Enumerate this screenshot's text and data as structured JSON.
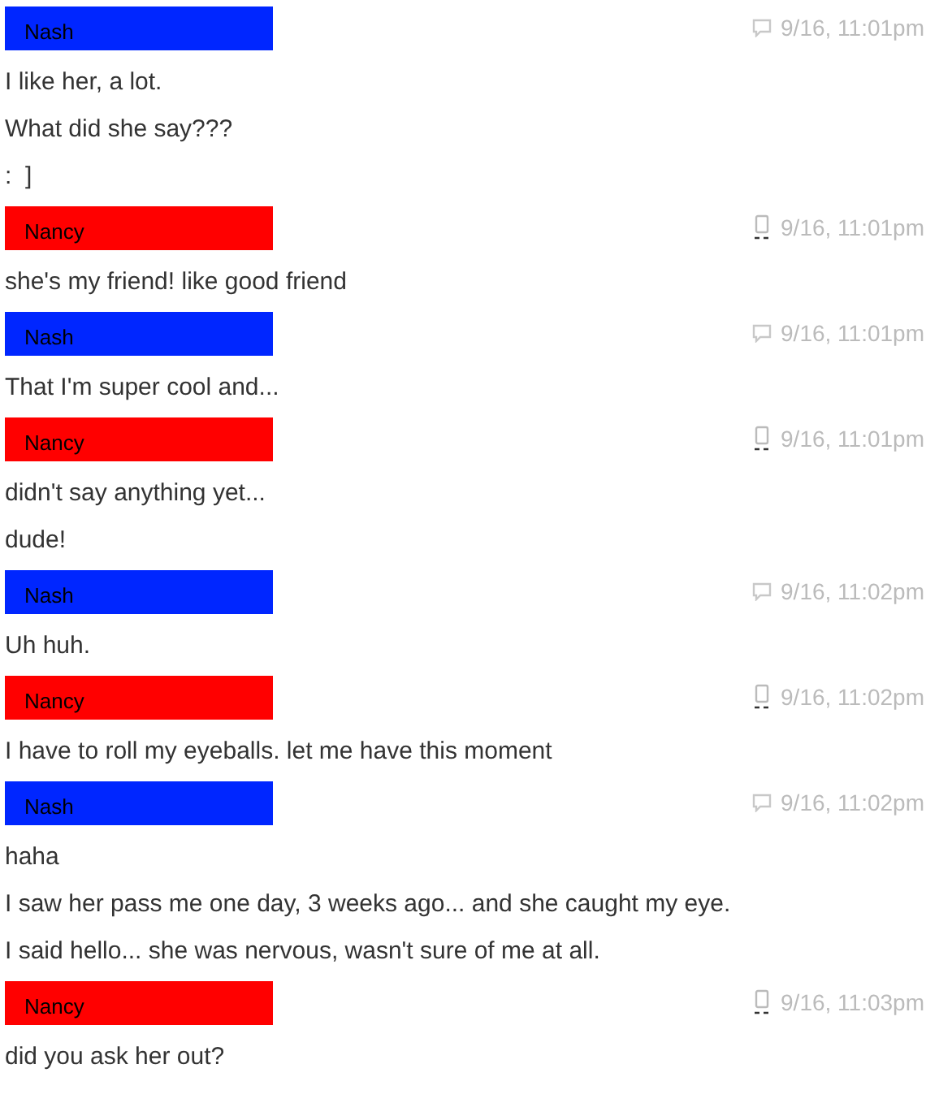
{
  "groups": [
    {
      "sender": "Nash",
      "color": "#0026ff",
      "kind": "chat",
      "time": "9/16, 11:01pm",
      "messages": [
        "I like her, a lot.",
        "What did she say???",
        ":  ]"
      ]
    },
    {
      "sender": "Nancy",
      "color": "#ff0000",
      "kind": "phone",
      "time": "9/16, 11:01pm",
      "messages": [
        "she's my friend! like good friend"
      ]
    },
    {
      "sender": "Nash",
      "color": "#0026ff",
      "kind": "chat",
      "time": "9/16, 11:01pm",
      "messages": [
        "That I'm super cool and..."
      ]
    },
    {
      "sender": "Nancy",
      "color": "#ff0000",
      "kind": "phone",
      "time": "9/16, 11:01pm",
      "messages": [
        "didn't say anything yet...",
        "dude!"
      ]
    },
    {
      "sender": "Nash",
      "color": "#0026ff",
      "kind": "chat",
      "time": "9/16, 11:02pm",
      "messages": [
        "Uh huh."
      ]
    },
    {
      "sender": "Nancy",
      "color": "#ff0000",
      "kind": "phone",
      "time": "9/16, 11:02pm",
      "messages": [
        "I have to roll my eyeballs. let me have this moment"
      ]
    },
    {
      "sender": "Nash",
      "color": "#0026ff",
      "kind": "chat",
      "time": "9/16, 11:02pm",
      "messages": [
        "haha",
        "I saw her pass me one day, 3 weeks ago... and she caught my eye.",
        "I said hello... she was nervous, wasn't sure of me at all."
      ]
    },
    {
      "sender": "Nancy",
      "color": "#ff0000",
      "kind": "phone",
      "time": "9/16, 11:03pm",
      "messages": [
        "did you ask her out?"
      ]
    }
  ]
}
